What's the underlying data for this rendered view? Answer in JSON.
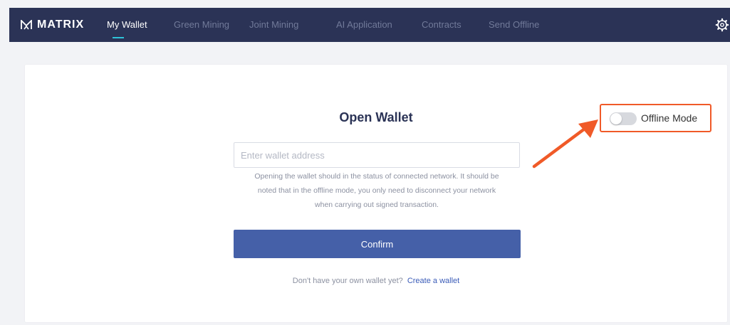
{
  "brand": {
    "name": "MATRIX"
  },
  "nav": {
    "items": [
      {
        "label": "My Wallet",
        "active": true
      },
      {
        "label": "Green Mining",
        "active": false
      },
      {
        "label": "Joint Mining",
        "active": false
      },
      {
        "label": "AI Application",
        "active": false
      },
      {
        "label": "Contracts",
        "active": false
      },
      {
        "label": "Send Offline",
        "active": false
      }
    ],
    "settings_icon": "gear-icon"
  },
  "main": {
    "title": "Open Wallet",
    "input": {
      "placeholder": "Enter wallet address",
      "value": ""
    },
    "hint_lines": [
      "Opening the wallet should in the status of connected network. It should be",
      "noted that in the offline mode, you only need to disconnect your network",
      "when carrying out signed transaction."
    ],
    "confirm_label": "Confirm",
    "footer_text": "Don't have your own wallet yet?",
    "footer_link": "Create a wallet"
  },
  "offline": {
    "label": "Offline Mode",
    "enabled": false
  },
  "colors": {
    "nav_bg": "#2b3356",
    "nav_active_underline": "#2ec3d8",
    "primary_button": "#4560a8",
    "link": "#3b5cb8",
    "highlight": "#f05a28",
    "page_bg": "#f2f3f6"
  }
}
